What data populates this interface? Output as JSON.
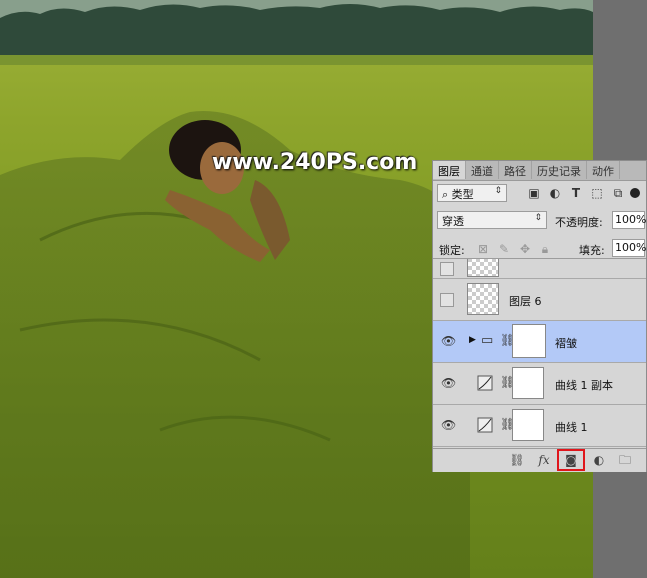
{
  "watermark": "www.240PS.com",
  "panel": {
    "tabs": [
      {
        "label": "图层",
        "active": true
      },
      {
        "label": "通道",
        "active": false
      },
      {
        "label": "路径",
        "active": false
      },
      {
        "label": "历史记录",
        "active": false
      },
      {
        "label": "动作",
        "active": false
      }
    ],
    "filter_kind": "类型",
    "blend_mode": "穿透",
    "opacity_label": "不透明度:",
    "opacity_value": "100%",
    "lock_label": "锁定:",
    "fill_label": "填充:",
    "fill_value": "100%",
    "layers": [
      {
        "name": "",
        "visible": false,
        "type": "partial"
      },
      {
        "name": "图层 6",
        "visible": false,
        "type": "pixel"
      },
      {
        "name": "褶皱",
        "visible": true,
        "type": "group",
        "selected": true
      },
      {
        "name": "曲线 1 副本",
        "visible": true,
        "type": "curves"
      },
      {
        "name": "曲线 1",
        "visible": true,
        "type": "curves"
      }
    ]
  },
  "colors": {
    "highlight": "#e0161c",
    "selected_row": "#b3c9f7"
  }
}
